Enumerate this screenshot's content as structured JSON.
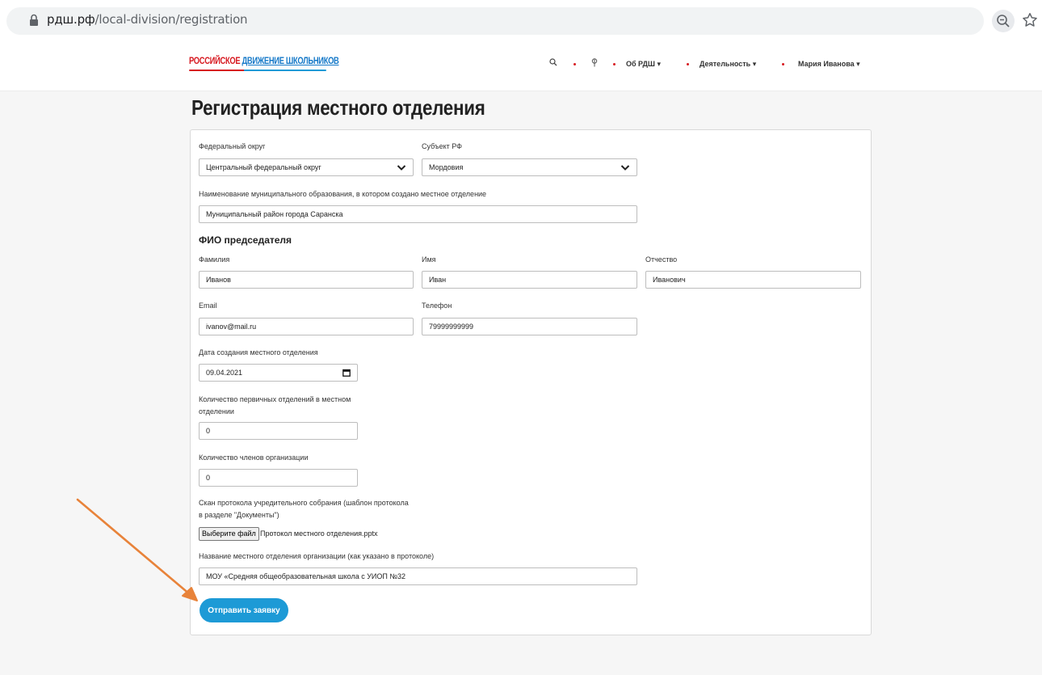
{
  "browser": {
    "url_host": "рдш.рф",
    "url_path": "/local-division/registration"
  },
  "header": {
    "logo_part1": "РОССИЙСКОЕ",
    "logo_part2": "ДВИЖЕНИЕ ШКОЛЬНИКОВ",
    "nav": {
      "about": "Об РДШ ▾",
      "activity": "Деятельность ▾",
      "user": "Мария Иванова ▾"
    }
  },
  "page": {
    "title": "Регистрация местного отделения"
  },
  "form": {
    "federal_district": {
      "label": "Федеральный округ",
      "value": "Центральный федеральный округ"
    },
    "region": {
      "label": "Субъект РФ",
      "value": "Мордовия"
    },
    "municipality": {
      "label": "Наименование муниципального образования, в котором создано местное отделение",
      "value": "Муниципальный район города Саранска"
    },
    "chair_section": "ФИО председателя",
    "last_name": {
      "label": "Фамилия",
      "value": "Иванов"
    },
    "first_name": {
      "label": "Имя",
      "value": "Иван"
    },
    "middle_name": {
      "label": "Отчество",
      "value": "Иванович"
    },
    "email": {
      "label": "Email",
      "value": "ivanov@mail.ru"
    },
    "phone": {
      "label": "Телефон",
      "value": "79999999999"
    },
    "created_date": {
      "label": "Дата создания местного отделения",
      "value": "09.04.2021"
    },
    "primary_count": {
      "label_line1": "Количество первичных отделений в местном",
      "label_line2": "отделении",
      "value": "0"
    },
    "members_count": {
      "label": "Количество членов организации",
      "value": "0"
    },
    "protocol_scan": {
      "label_line1": "Скан протокола учредительного собрания (шаблон протокола",
      "label_line2": "в разделе \"Документы\")",
      "button": "Выберите файл",
      "file_name": "Протокол местного отделения.pptx"
    },
    "org_name": {
      "label": "Название местного отделения организации (как указано в протоколе)",
      "value": "МОУ «Средняя общеобразовательная школа с УИОП №32"
    },
    "submit": "Отправить заявку"
  },
  "colors": {
    "accent_blue": "#1d9ad6",
    "logo_red": "#d71920",
    "annotation_arrow": "#e8833a"
  }
}
